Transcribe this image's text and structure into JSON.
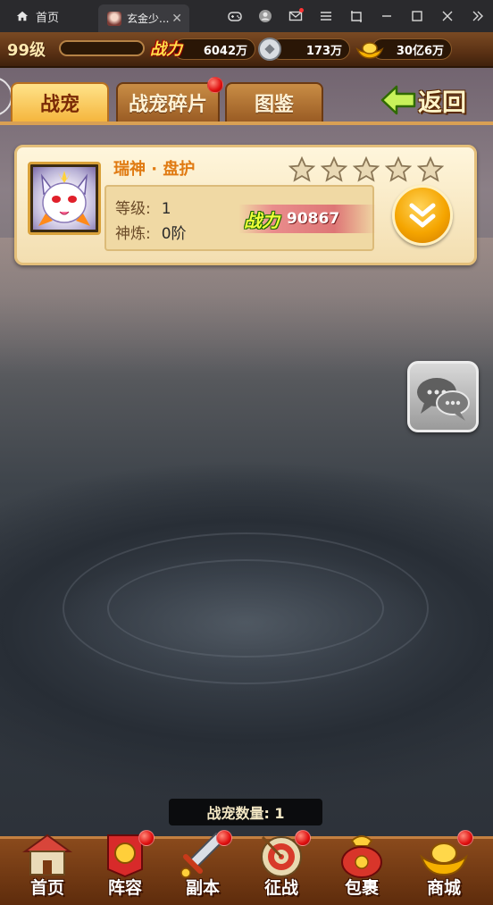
{
  "window": {
    "home_tab_label": "首页",
    "game_tab_label": "玄金少...",
    "close_glyph": "✕",
    "icons": [
      "gamepad-icon",
      "user-icon",
      "mail-icon",
      "menu-icon",
      "screenshot-icon",
      "minimize-icon",
      "maximize-icon",
      "close-icon",
      "collapse-icon"
    ]
  },
  "status": {
    "level": "99级",
    "power_badge": "战力",
    "power_value": "6042万",
    "silver_value": "173万",
    "gold_value": "30亿6万"
  },
  "tabs": [
    {
      "label": "战宠",
      "active": true
    },
    {
      "label": "战宠碎片",
      "active": false,
      "has_dot": true
    },
    {
      "label": "图鉴",
      "active": false
    }
  ],
  "back_label": "返回",
  "pet": {
    "name": "瑞神 · 盘护",
    "stars": 5,
    "level_label": "等级:",
    "level_value": "1",
    "refine_label": "神炼:",
    "refine_value": "0阶",
    "power_label": "战力",
    "power_value": "90867"
  },
  "count_label": "战宠数量: 1",
  "nav": [
    {
      "label": "首页",
      "icon": "house-icon",
      "dot": false
    },
    {
      "label": "阵容",
      "icon": "banner-icon",
      "dot": true
    },
    {
      "label": "副本",
      "icon": "sword-icon",
      "dot": true
    },
    {
      "label": "征战",
      "icon": "target-icon",
      "dot": true
    },
    {
      "label": "包裹",
      "icon": "bag-icon",
      "dot": false
    },
    {
      "label": "商城",
      "icon": "gold-ingot-icon",
      "dot": true
    }
  ],
  "colors": {
    "accent_orange": "#f5a500",
    "name_orange": "#e07a12",
    "power_green": "#f0ff3a",
    "notification_red": "#e01010"
  }
}
